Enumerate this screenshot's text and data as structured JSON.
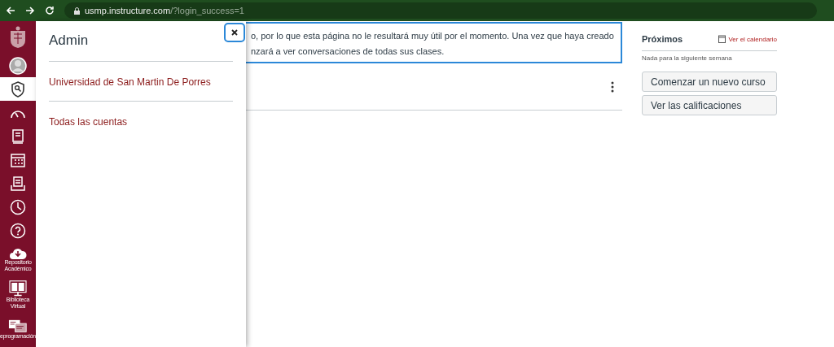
{
  "browser": {
    "url_host": "usmp.instructure.com",
    "url_path": "/?login_success=1"
  },
  "sidebar": {
    "items": [
      {
        "kind": "logo",
        "selected": false
      },
      {
        "kind": "account",
        "selected": false
      },
      {
        "kind": "admin",
        "selected": true
      },
      {
        "kind": "dashboard",
        "selected": false
      },
      {
        "kind": "courses",
        "selected": false
      },
      {
        "kind": "calendar",
        "selected": false
      },
      {
        "kind": "inbox",
        "selected": false
      },
      {
        "kind": "history",
        "selected": false
      },
      {
        "kind": "help",
        "selected": false
      },
      {
        "kind": "repository",
        "selected": false,
        "label": "Repositorio Académico"
      },
      {
        "kind": "library",
        "selected": false,
        "label": "Biblioteca Virtual"
      },
      {
        "kind": "schedule",
        "selected": false,
        "label": "eprogramación"
      }
    ]
  },
  "tray": {
    "title": "Admin",
    "links": [
      "Universidad de San Martin De Porres",
      "Todas las cuentas"
    ]
  },
  "banner": {
    "lines": [
      "o, por lo que esta página no le resultará muy útil por el momento. Una vez que haya creado",
      "nzará a ver conversaciones de todas sus clases."
    ]
  },
  "upcoming": {
    "title": "Próximos",
    "calendar_link": "Ver el calendario",
    "empty_text": "Nada para la siguiente semana"
  },
  "buttons": [
    "Comenzar un nuevo curso",
    "Ver las calificaciones"
  ]
}
